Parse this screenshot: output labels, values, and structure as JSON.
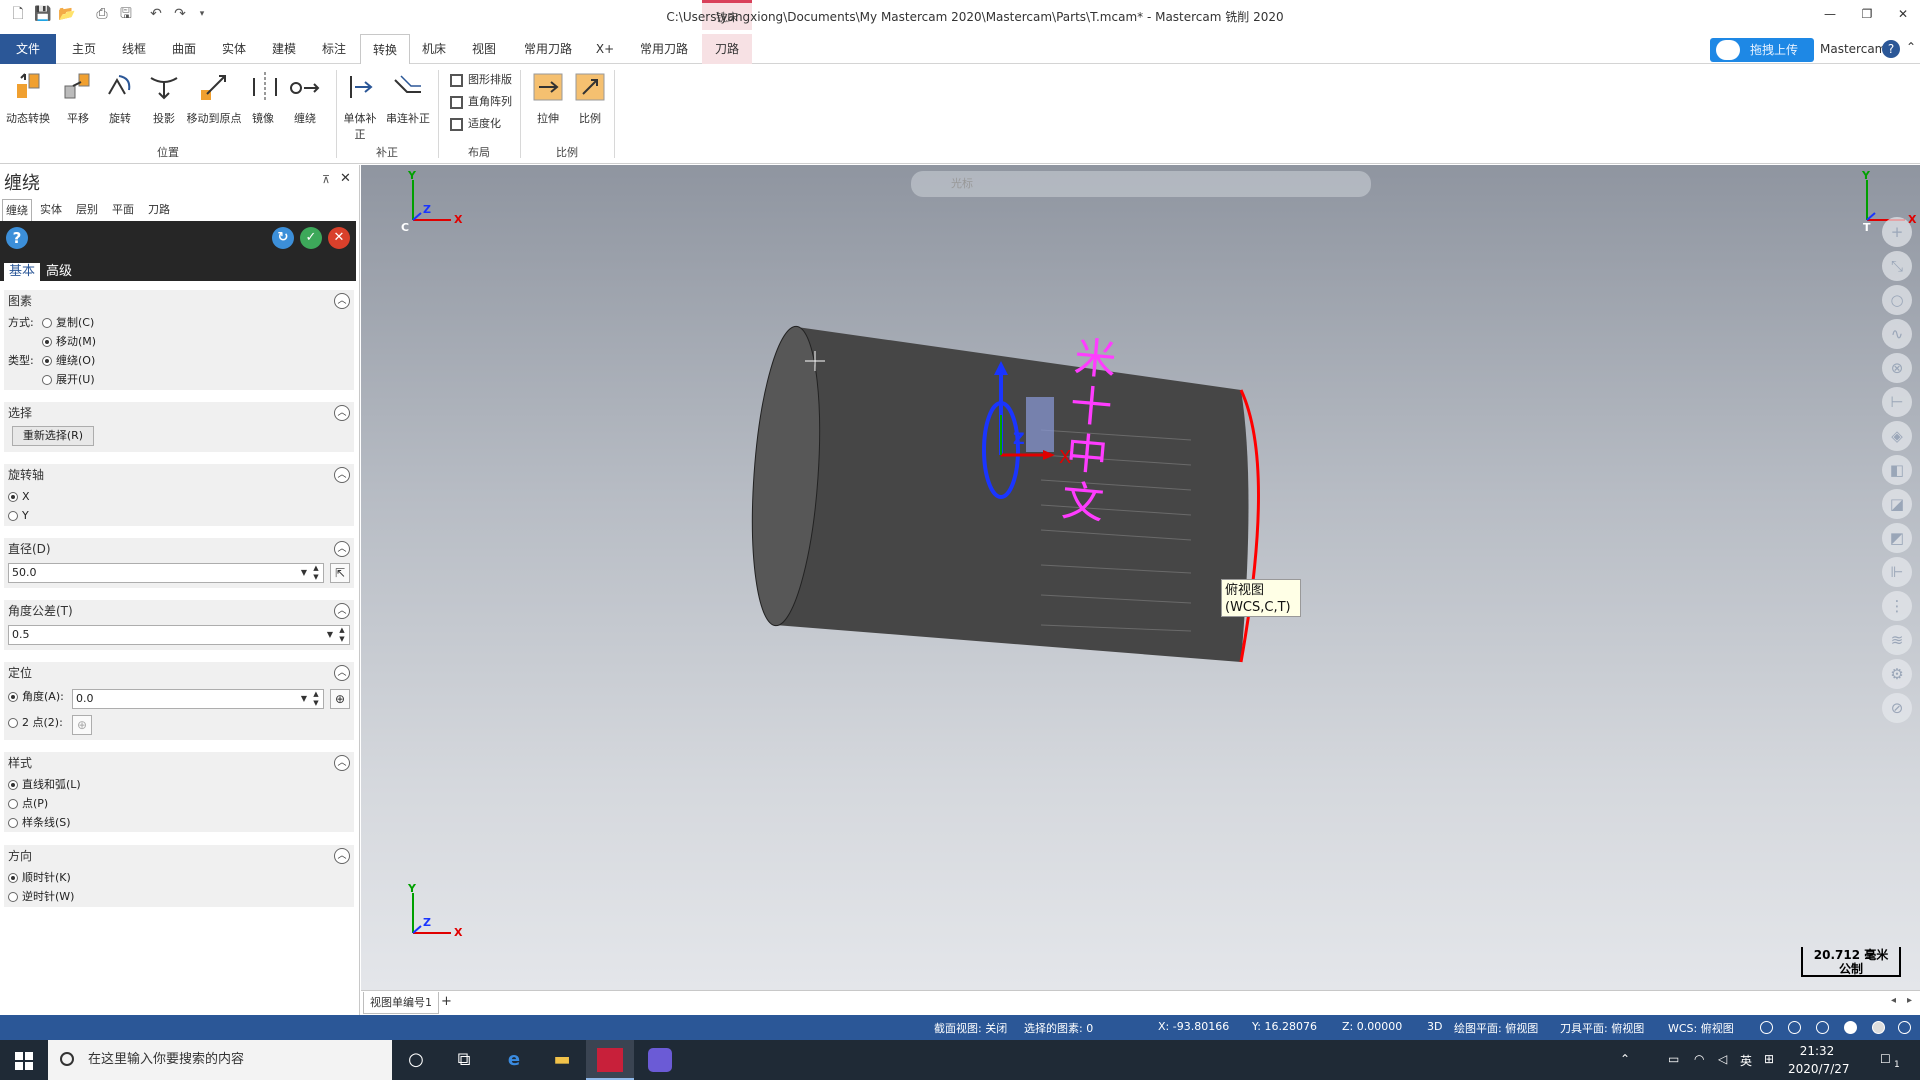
{
  "titlebar": {
    "title": "C:\\Users\\yangxiong\\Documents\\My Mastercam 2020\\Mastercam\\Parts\\T.mcam* - Mastercam 铣削 2020",
    "context_tab_head": "铣床",
    "minimize": "—",
    "restore": "❐",
    "close": "✕"
  },
  "tabs": [
    {
      "label": "文件"
    },
    {
      "label": "主页"
    },
    {
      "label": "线框"
    },
    {
      "label": "曲面"
    },
    {
      "label": "实体"
    },
    {
      "label": "建模"
    },
    {
      "label": "标注"
    },
    {
      "label": "转换"
    },
    {
      "label": "机床"
    },
    {
      "label": "视图"
    },
    {
      "label": "常用刀路"
    },
    {
      "label": "X+"
    },
    {
      "label": "常用刀路"
    },
    {
      "label": "刀路"
    }
  ],
  "upload_button": "拖拽上传",
  "mastercam_label": "Mastercam",
  "help_icon": "?",
  "ribbon": {
    "buttons": [
      {
        "label": "动态转换"
      },
      {
        "label": "平移"
      },
      {
        "label": "旋转"
      },
      {
        "label": "投影"
      },
      {
        "label": "移动到原点"
      },
      {
        "label": "镜像"
      },
      {
        "label": "缠绕"
      },
      {
        "label": "单体补正"
      },
      {
        "label": "串连补正"
      },
      {
        "label": "拉伸"
      },
      {
        "label": "比例"
      }
    ],
    "small_buttons": [
      {
        "label": "图形排版"
      },
      {
        "label": "直角阵列"
      },
      {
        "label": "适度化"
      }
    ],
    "groups": {
      "position": "位置",
      "offset": "补正",
      "layout": "布局",
      "scale": "比例"
    }
  },
  "panel": {
    "title": "缠绕",
    "pin": "⊼",
    "close": "✕",
    "tabs": [
      "缠绕",
      "实体",
      "层别",
      "平面",
      "刀路"
    ],
    "subtabs": {
      "basic": "基本",
      "advanced": "高级"
    },
    "header_buttons": {
      "help": "?",
      "apply": "↻",
      "ok": "✓",
      "cancel": "✕"
    },
    "entities": {
      "title": "图素",
      "method_label": "方式:",
      "copy": "复制(C)",
      "move": "移动(M)",
      "type_label": "类型:",
      "wrap": "缠绕(O)",
      "unroll": "展开(U)"
    },
    "selection": {
      "title": "选择",
      "reselect": "重新选择(R)"
    },
    "rotation_axis": {
      "title": "旋转轴",
      "x": "X",
      "y": "Y"
    },
    "diameter": {
      "title": "直径(D)",
      "value": "50.0"
    },
    "angle_tolerance": {
      "title": "角度公差(T)",
      "value": "0.5"
    },
    "positioning": {
      "title": "定位",
      "angle_label": "角度(A):",
      "angle_value": "0.0",
      "two_point": "2 点(2):"
    },
    "style": {
      "title": "样式",
      "lines_arcs": "直线和弧(L)",
      "points": "点(P)",
      "splines": "样条线(S)"
    },
    "direction": {
      "title": "方向",
      "cw": "顺时针(K)",
      "ccw": "逆时针(W)"
    }
  },
  "viewport": {
    "float_toolbar": "光标",
    "tooltip_line1": "俯视图",
    "tooltip_line2": "(WCS,C,T)",
    "scale_value": "20.712 毫米",
    "scale_unit": "公制",
    "cylinder_text": [
      "米",
      "十",
      "中",
      "文"
    ],
    "colors": {
      "cylinder": "#4a4a4a",
      "text": "#ff3cff",
      "edge": "#ff0000",
      "axis_z": "#1a35ff",
      "axis_x": "#e00000",
      "axis_y": "#00a000"
    },
    "axes": {
      "x": "X",
      "y": "Y",
      "z": "Z",
      "c": "C",
      "t": "T"
    }
  },
  "viewsheet": {
    "tab": "视图单编号1",
    "add": "+"
  },
  "statusbar": {
    "section_view": "截面视图: 关闭",
    "selected": "选择的图素: 0",
    "x": "X:   -93.80166",
    "y": "Y:   16.28076",
    "z": "Z:   0.00000",
    "mode": "3D",
    "gplane": "绘图平面: 俯视图",
    "tplane": "刀具平面: 俯视图",
    "wcs": "WCS: 俯视图"
  },
  "taskbar": {
    "search_placeholder": "在这里输入你要搜索的内容",
    "time": "21:32",
    "date": "2020/7/27",
    "ime": "英",
    "notification_count": "1"
  }
}
